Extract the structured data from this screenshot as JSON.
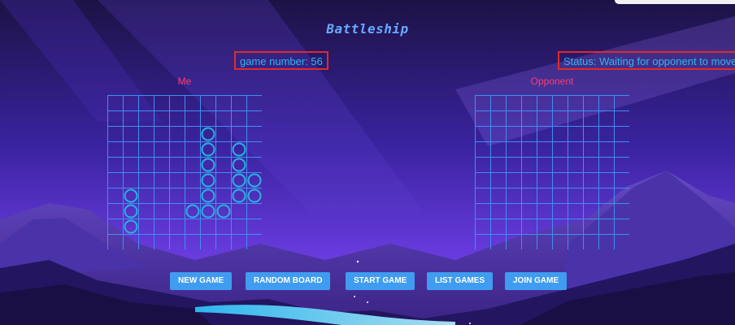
{
  "title": "Battleship",
  "game_number": "game number: 56",
  "status": "Status: Waiting for opponent to move",
  "boards": {
    "me": {
      "label": "Me",
      "ship_cells": [
        {
          "row": 2,
          "col": 6
        },
        {
          "row": 3,
          "col": 6
        },
        {
          "row": 3,
          "col": 8
        },
        {
          "row": 4,
          "col": 6
        },
        {
          "row": 4,
          "col": 8
        },
        {
          "row": 5,
          "col": 6
        },
        {
          "row": 5,
          "col": 8
        },
        {
          "row": 5,
          "col": 9
        },
        {
          "row": 6,
          "col": 1
        },
        {
          "row": 6,
          "col": 6
        },
        {
          "row": 6,
          "col": 8
        },
        {
          "row": 6,
          "col": 9
        },
        {
          "row": 7,
          "col": 1
        },
        {
          "row": 7,
          "col": 5
        },
        {
          "row": 7,
          "col": 6
        },
        {
          "row": 7,
          "col": 7
        },
        {
          "row": 8,
          "col": 1
        }
      ]
    },
    "opponent": {
      "label": "Opponent",
      "ship_cells": []
    }
  },
  "grid": {
    "rows": 10,
    "cols": 10
  },
  "buttons": {
    "new_game": "NEW GAME",
    "random_board": "RANDOM BOARD",
    "start_game": "START GAME",
    "list_games": "LIST GAMES",
    "join_game": "JOIN GAME"
  },
  "colors": {
    "title": "#66aaff",
    "board_label": "#ff3b6b",
    "grid_line": "#3f8ff0",
    "ship_circle": "#28b3de",
    "highlight_border": "#e02a2a",
    "status_text": "#33b6ee",
    "button": "#3f9cf0"
  }
}
